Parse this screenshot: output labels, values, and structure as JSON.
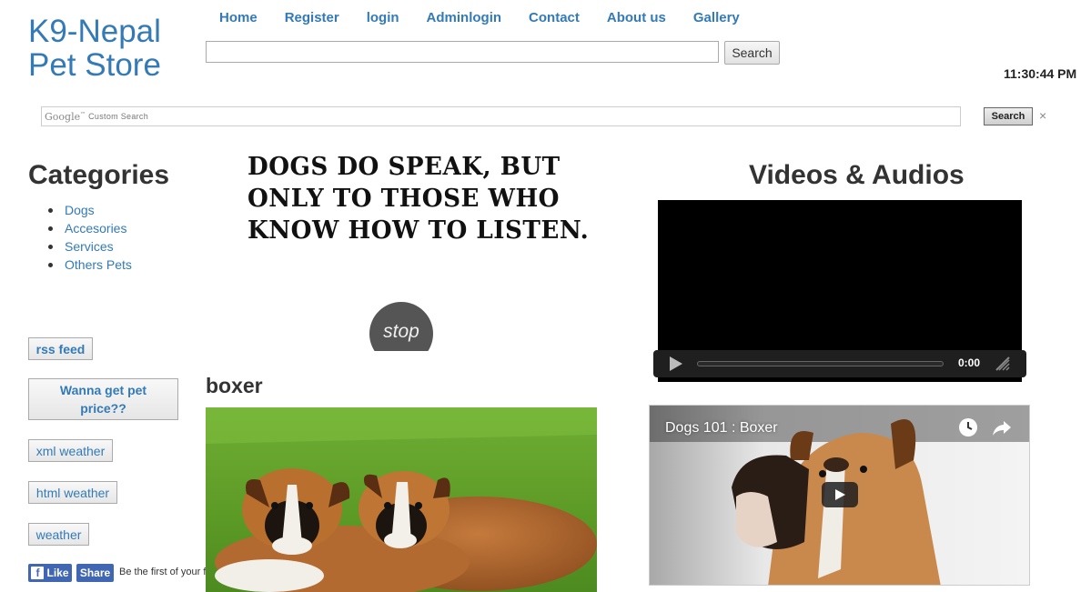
{
  "brand": {
    "line1": "K9-Nepal",
    "line2": "Pet Store"
  },
  "nav": [
    "Home",
    "Register",
    "login",
    "Adminlogin",
    "Contact",
    "About us",
    "Gallery"
  ],
  "top_search": {
    "value": "",
    "button": "Search"
  },
  "clock": "11:30:44 PM",
  "google_search": {
    "logo": "Google",
    "tm": "™",
    "placeholder": "Custom Search",
    "button": "Search",
    "clear": "×"
  },
  "categories": {
    "title": "Categories",
    "items": [
      "Dogs",
      "Accesories",
      "Services",
      "Others Pets"
    ]
  },
  "quote": "DOGS DO SPEAK, BUT ONLY TO THOSE WHO KNOW HOW TO LISTEN.",
  "stop_button": "stop",
  "side_buttons": {
    "rss": "rss feed",
    "pet_price": "Wanna get pet price??",
    "xml_weather": "xml weather",
    "html_weather": "html weather",
    "weather": "weather"
  },
  "facebook": {
    "like": "Like",
    "share": "Share",
    "text": "Be the first of your friends to like this"
  },
  "boxer": {
    "title": "boxer"
  },
  "videos": {
    "title": "Videos & Audios",
    "audio_time": "0:00",
    "youtube_title": "Dogs 101 : Boxer"
  },
  "colors": {
    "link": "#337ab7",
    "facebook": "#4267b2"
  }
}
